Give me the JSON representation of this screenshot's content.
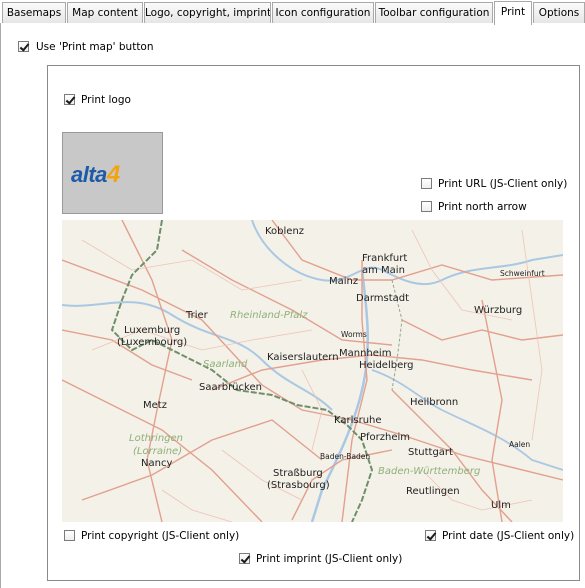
{
  "tabs": [
    {
      "label": "Basemaps",
      "active": false
    },
    {
      "label": "Map content",
      "active": false
    },
    {
      "label": "Logo, copyright, imprint",
      "active": false
    },
    {
      "label": "Icon configuration",
      "active": false
    },
    {
      "label": "Toolbar configuration",
      "active": false
    },
    {
      "label": "Print",
      "active": true
    },
    {
      "label": "Options",
      "active": false
    }
  ],
  "print": {
    "use_print_button": {
      "label": "Use 'Print map' button",
      "checked": true
    },
    "print_logo": {
      "label": "Print logo",
      "checked": true
    },
    "print_url": {
      "label": "Print URL (JS-Client only)",
      "checked": false
    },
    "print_north_arrow": {
      "label": "Print north arrow",
      "checked": false
    },
    "print_copyright": {
      "label": "Print copyright (JS-Client only)",
      "checked": false
    },
    "print_date": {
      "label": "Print date (JS-Client only)",
      "checked": true
    },
    "print_imprint": {
      "label": "Print imprint (JS-Client only)",
      "checked": true
    }
  },
  "logo": {
    "text_main": "alta",
    "text_accent": "4"
  },
  "map": {
    "cities": {
      "koblenz": "Koblenz",
      "frankfurt": "Frankfurt",
      "frankfurt2": "am Main",
      "schweinfurt": "Schweinfurt",
      "mainz": "Mainz",
      "darmstadt": "Darmstadt",
      "wuerzburg": "Würzburg",
      "trier": "Trier",
      "luxembourg": "Luxemburg",
      "luxembourg2": "(Luxembourg)",
      "worms": "Worms",
      "kaiserslautern": "Kaiserslautern",
      "mannheim": "Mannheim",
      "heidelberg": "Heidelberg",
      "saarbruecken": "Saarbrücken",
      "metz": "Metz",
      "heilbronn": "Heilbronn",
      "karlsruhe": "Karlsruhe",
      "pforzheim": "Pforzheim",
      "stuttgart": "Stuttgart",
      "aalen": "Aalen",
      "baden": "Baden-Baden",
      "nancy": "Nancy",
      "strasbourg": "Straßburg",
      "strasbourg2": "(Strasbourg)",
      "reutlingen": "Reutlingen",
      "ulm": "Ulm"
    },
    "regions": {
      "rlp": "Rheinland-Pfalz",
      "saarland": "Saarland",
      "lothringen": "Lothringen",
      "lorraine": "(Lorraine)",
      "bw": "Baden-Württemberg"
    },
    "colors": {
      "land": "#f4f1e8",
      "road": "#e2a08e",
      "border": "#6f8f6a",
      "water": "#a9c8e3"
    }
  }
}
